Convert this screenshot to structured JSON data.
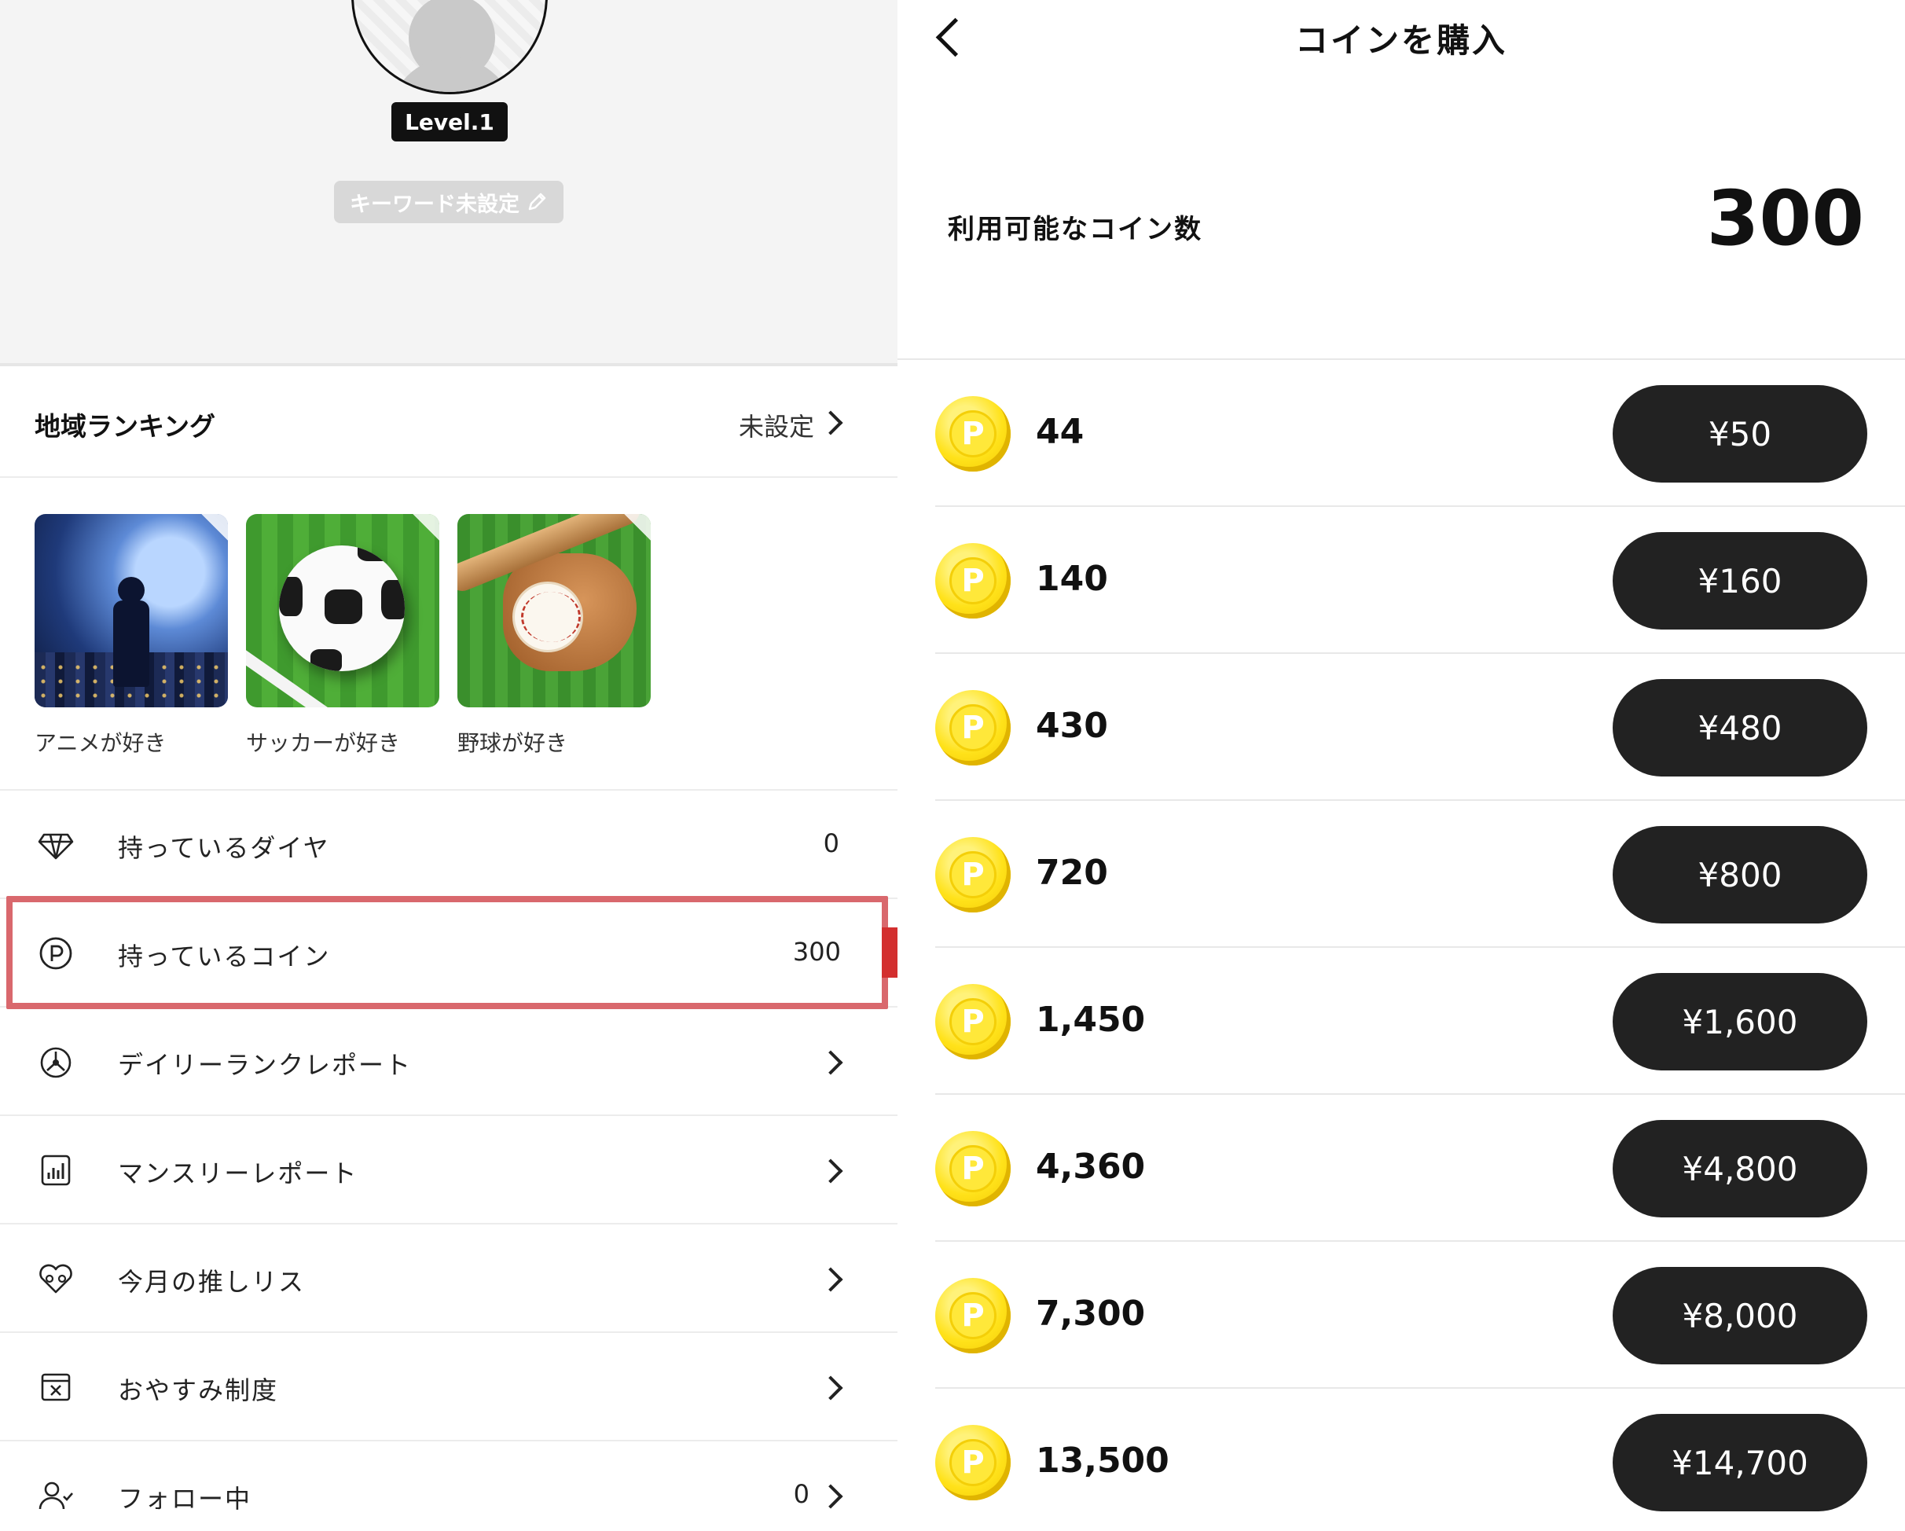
{
  "profile": {
    "level": "Level.1",
    "keyword": "キーワード未設定"
  },
  "region_ranking": {
    "title": "地域ランキング",
    "value": "未設定"
  },
  "interests": [
    {
      "label": "アニメが好き"
    },
    {
      "label": "サッカーが好き"
    },
    {
      "label": "野球が好き"
    }
  ],
  "menu": [
    {
      "label": "持っているダイヤ",
      "value": "0",
      "icon": "diamond-icon"
    },
    {
      "label": "持っているコイン",
      "value": "300",
      "icon": "coin-icon"
    },
    {
      "label": "デイリーランクレポート",
      "value": "",
      "icon": "daily-rank-icon"
    },
    {
      "label": "マンスリーレポート",
      "value": "",
      "icon": "monthly-report-icon"
    },
    {
      "label": "今月の推しリス",
      "value": "",
      "icon": "heart-list-icon"
    },
    {
      "label": "おやすみ制度",
      "value": "",
      "icon": "calendar-x-icon"
    },
    {
      "label": "フォロー中",
      "value": "0",
      "icon": "person-follow-icon"
    }
  ],
  "purchase": {
    "title": "コインを購入",
    "balance_label": "利用可能なコイン数",
    "balance": "300",
    "packages": [
      {
        "coins": "44",
        "price": "¥50"
      },
      {
        "coins": "140",
        "price": "¥160"
      },
      {
        "coins": "430",
        "price": "¥480"
      },
      {
        "coins": "720",
        "price": "¥800"
      },
      {
        "coins": "1,450",
        "price": "¥1,600"
      },
      {
        "coins": "4,360",
        "price": "¥4,800"
      },
      {
        "coins": "7,300",
        "price": "¥8,000"
      },
      {
        "coins": "13,500",
        "price": "¥14,700"
      }
    ]
  },
  "colors": {
    "highlight": "#d9686d",
    "arrow": "#d32f2f",
    "coin": "#ffe21a",
    "button": "#222222"
  }
}
